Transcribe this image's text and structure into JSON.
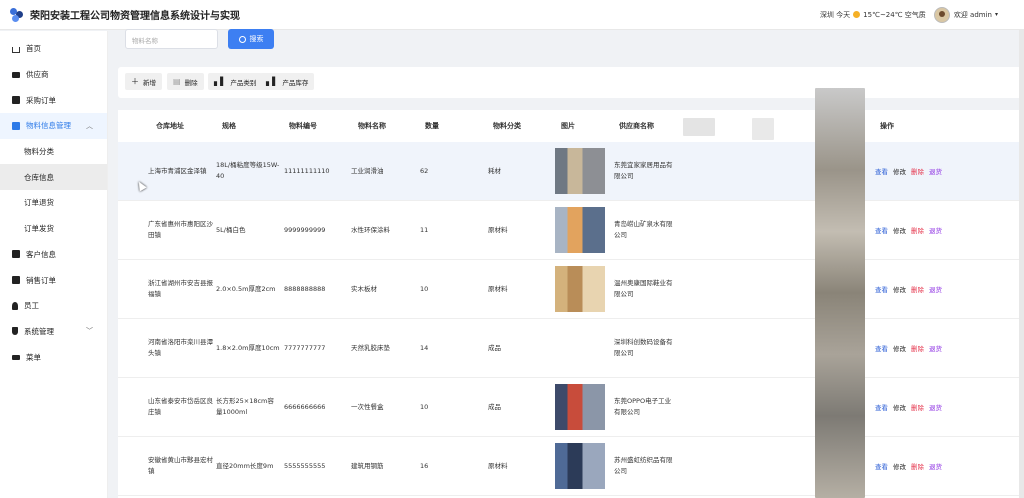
{
  "header": {
    "title": "荣阳安装工程公司物资管理信息系统设计与实现",
    "weather": "深圳 今天",
    "temp": "15℃~24℃ 空气质",
    "welcome": "欢迎 admin"
  },
  "sidebar": {
    "items": [
      {
        "label": "首页",
        "icon": "home-icon"
      },
      {
        "label": "供应商",
        "icon": "monitor-icon"
      },
      {
        "label": "采购订单",
        "icon": "shop-icon"
      },
      {
        "label": "物料信息管理",
        "icon": "grid-icon"
      },
      {
        "label": "物料分类",
        "icon": ""
      },
      {
        "label": "仓库信息",
        "icon": ""
      },
      {
        "label": "订单退货",
        "icon": ""
      },
      {
        "label": "订单发货",
        "icon": ""
      },
      {
        "label": "客户信息",
        "icon": "printer-icon"
      },
      {
        "label": "销售订单",
        "icon": "grid-icon"
      },
      {
        "label": "员工",
        "icon": "user-icon"
      },
      {
        "label": "系统管理",
        "icon": "shield-icon"
      },
      {
        "label": "菜单",
        "icon": "keyboard-icon"
      }
    ]
  },
  "search": {
    "placeholder": "物料名称",
    "button": "搜索"
  },
  "toolbar": {
    "add": "新增",
    "delete": "删除",
    "category": "产品类别",
    "stock": "产品库存"
  },
  "table": {
    "headers": [
      "仓库地址",
      "规格",
      "物料编号",
      "物料名称",
      "数量",
      "物料分类",
      "图片",
      "供应商名称",
      "操作"
    ],
    "ops": {
      "view": "查看",
      "edit": "修改",
      "delete": "删除",
      "return": "退货"
    },
    "rows": [
      {
        "addr": "上海市青浦区金泽镇",
        "spec": "18L/桶粘度等级15W-40",
        "code": "11111111110",
        "name": "工业润滑油",
        "qty": "62",
        "cat": "耗材",
        "supplier": "东莞宜家家居用品有限公司",
        "has_pic": true
      },
      {
        "addr": "广东省惠州市惠阳区沙田镇",
        "spec": "5L/桶白色",
        "code": "9999999999",
        "name": "水性环保涂料",
        "qty": "11",
        "cat": "原材料",
        "supplier": "青岛崂山矿泉水有限公司",
        "has_pic": true
      },
      {
        "addr": "浙江省湖州市安吉县报福镇",
        "spec": "2.0×0.5m厚度2cm",
        "code": "8888888888",
        "name": "实木板材",
        "qty": "10",
        "cat": "原材料",
        "supplier": "温州奥康国际鞋业有限公司",
        "has_pic": true
      },
      {
        "addr": "河南省洛阳市栾川县潭头镇",
        "spec": "1.8×2.0m厚度10cm",
        "code": "7777777777",
        "name": "天然乳胶床垫",
        "qty": "14",
        "cat": "成品",
        "supplier": "深圳科创数码设备有限公司",
        "has_pic": false
      },
      {
        "addr": "山东省泰安市岱岳区良庄镇",
        "spec": "长方形25×18cm容量1000ml",
        "code": "6666666666",
        "name": "一次性餐盒",
        "qty": "10",
        "cat": "成品",
        "supplier": "东莞OPPO电子工业有限公司",
        "has_pic": true
      },
      {
        "addr": "安徽省黄山市黟县宏村镇",
        "spec": "直径20mm长度9m",
        "code": "5555555555",
        "name": "建筑用钢筋",
        "qty": "16",
        "cat": "原材料",
        "supplier": "苏州盛虹纺织品有限公司",
        "has_pic": true
      }
    ]
  },
  "colors": {
    "accent": "#3d7ff2",
    "delete": "#e5334b",
    "return": "#8a2be2",
    "view": "#2d5fd6",
    "edit": "#222222"
  }
}
